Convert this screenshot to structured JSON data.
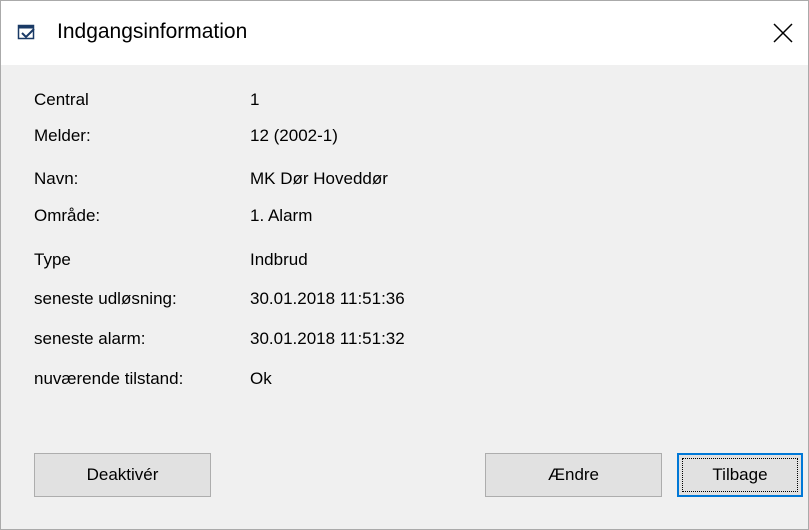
{
  "window": {
    "title": "Indgangsinformation",
    "app_icon": "dialog-app-icon",
    "close_icon": "close-icon"
  },
  "fields": [
    {
      "label": "Central",
      "value": "1"
    },
    {
      "label": "Melder:",
      "value": "12 (2002-1)"
    },
    {
      "label": "Navn:",
      "value": "MK Dør Hoveddør"
    },
    {
      "label": "Område:",
      "value": "1. Alarm"
    },
    {
      "label": "Type",
      "value": "Indbrud"
    },
    {
      "label": "seneste udløsning:",
      "value": "30.01.2018 11:51:36"
    },
    {
      "label": "seneste alarm:",
      "value": "30.01.2018 11:51:32"
    },
    {
      "label": "nuværende tilstand:",
      "value": "Ok"
    }
  ],
  "buttons": {
    "deactivate_label": "Deaktivér",
    "change_label": "Ændre",
    "back_label": "Tilbage"
  },
  "colors": {
    "focus_border": "#0078d7",
    "button_face": "#e1e1e1",
    "dialog_background": "#f0f0f0"
  }
}
